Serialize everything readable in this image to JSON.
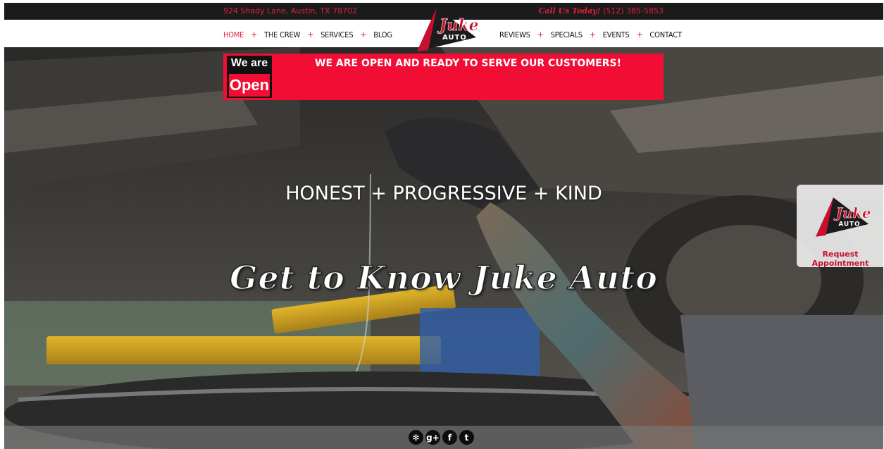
{
  "topbar": {
    "address": "924 Shady Lane,  Austin,  TX 78702",
    "call_label": "Call Us Today!",
    "phone": "(512) 385-5853"
  },
  "nav": {
    "left": [
      {
        "label": "HOME",
        "active": true
      },
      {
        "label": "THE CREW"
      },
      {
        "label": "SERVICES"
      },
      {
        "label": "BLOG"
      }
    ],
    "right": [
      {
        "label": "REVIEWS"
      },
      {
        "label": "SPECIALS"
      },
      {
        "label": "EVENTS"
      },
      {
        "label": "CONTACT"
      }
    ],
    "separator": "+"
  },
  "logo": {
    "line1": "Juke",
    "line2": "AUTO"
  },
  "banner": {
    "badge_top": "We are",
    "badge_bottom": "Open",
    "message": "WE ARE OPEN AND READY TO SERVE OUR CUSTOMERS!"
  },
  "hero": {
    "tagline": "HONEST + PROGRESSIVE + KIND",
    "script_heading": "Get to Know Juke Auto"
  },
  "side_widget": {
    "label": "Request Appointment"
  },
  "social": [
    {
      "name": "yelp-icon",
      "glyph": "✻"
    },
    {
      "name": "google-plus-icon",
      "glyph": "g+"
    },
    {
      "name": "facebook-icon",
      "glyph": "f"
    },
    {
      "name": "twitter-icon",
      "glyph": "t"
    }
  ],
  "colors": {
    "accent": "#e0203a",
    "banner": "#f20d35",
    "dark": "#1b1b1b"
  }
}
